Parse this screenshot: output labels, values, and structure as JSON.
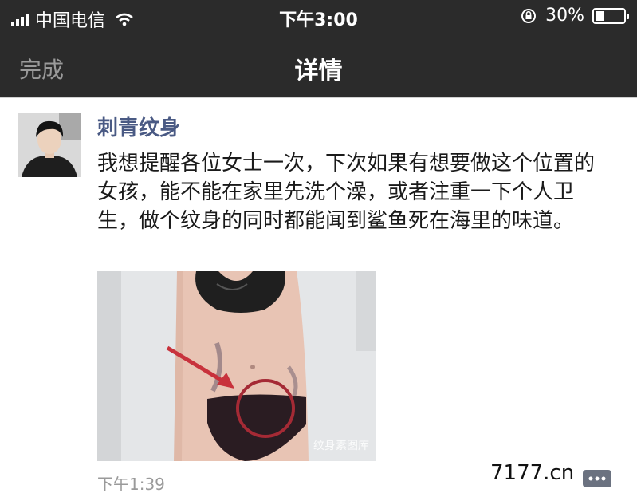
{
  "status_bar": {
    "carrier": "中国电信",
    "time": "下午3:00",
    "battery_text": "30%",
    "battery_level": 0.3,
    "icons": [
      "signal-icon",
      "wifi-icon",
      "orientation-lock-icon",
      "battery-icon"
    ]
  },
  "nav": {
    "done_label": "完成",
    "title": "详情"
  },
  "post": {
    "author": "刺青纹身",
    "text": "我想提醒各位女士一次，下次如果有想要做这个位置的女孩，能不能在家里先洗个澡，或者注重一下个人卫生，做个纹身的同时都能闻到鲨鱼死在海里的味道。",
    "timestamp": "下午1:39",
    "photo_caption": "纹身素图库"
  },
  "watermark": "7177.cn",
  "colors": {
    "bar_bg": "#2b2b2b",
    "author_name": "#4a5a84",
    "muted": "#9a9a9a"
  }
}
